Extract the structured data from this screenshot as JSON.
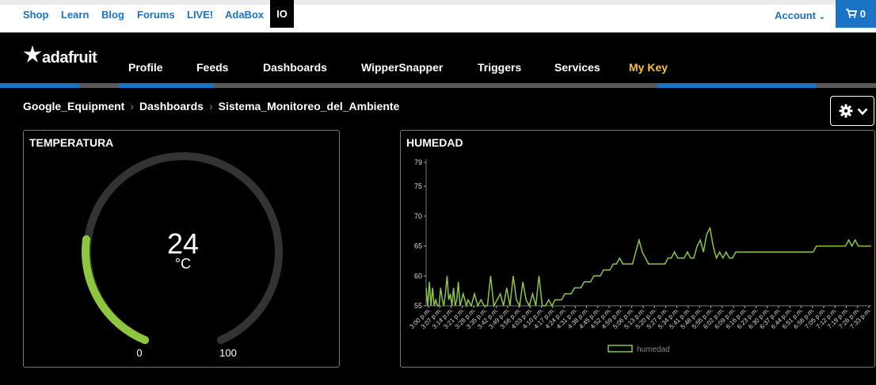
{
  "topnav": {
    "links": [
      "Shop",
      "Learn",
      "Blog",
      "Forums",
      "LIVE!",
      "AdaBox"
    ],
    "active": "IO",
    "account": "Account",
    "cart_count": "0"
  },
  "mainnav": {
    "brand": "adafruit",
    "items": [
      "Profile",
      "Feeds",
      "Dashboards",
      "WipperSnapper",
      "Triggers",
      "Services"
    ],
    "my_key": "My Key"
  },
  "breadcrumb": [
    "Google_Equipment",
    "Dashboards",
    "Sistema_Monitoreo_del_Ambiente"
  ],
  "colors": {
    "accent": "#1a73c4",
    "key": "#f6c23e",
    "series": "#8dc63f"
  },
  "gauge": {
    "title": "TEMPERATURA",
    "value": "24",
    "unit": "°C",
    "min": "0",
    "max": "100"
  },
  "chart_data": {
    "type": "line",
    "title": "HUMEDAD",
    "ylim": [
      55,
      79
    ],
    "y_ticks": [
      55,
      60,
      65,
      70,
      75,
      79
    ],
    "x_ticks": [
      "3:00 p.m.",
      "3:07 p.m.",
      "3:14 p.m.",
      "3:21 p.m.",
      "3:28 p.m.",
      "3:35 p.m.",
      "3:42 p.m.",
      "3:49 p.m.",
      "3:56 p.m.",
      "4:03 p.m.",
      "4:10 p.m.",
      "4:17 p.m.",
      "4:24 p.m.",
      "4:31 p.m.",
      "4:38 p.m.",
      "4:45 p.m.",
      "4:52 p.m.",
      "4:59 p.m.",
      "5:06 p.m.",
      "5:13 p.m.",
      "5:20 p.m.",
      "5:27 p.m.",
      "5:34 p.m.",
      "5:41 p.m.",
      "5:48 p.m.",
      "5:55 p.m.",
      "6:02 p.m.",
      "6:09 p.m.",
      "6:16 p.m.",
      "6:23 p.m.",
      "6:30 p.m.",
      "6:37 p.m.",
      "6:44 p.m.",
      "6:51 p.m.",
      "6:58 p.m.",
      "7:05 p.m.",
      "7:12 p.m.",
      "7:19 p.m.",
      "7:26 p.m.",
      "7:33 p.m."
    ],
    "series": [
      {
        "name": "humedad",
        "x": [
          0,
          1,
          2,
          3,
          4,
          5,
          6,
          7,
          8,
          9,
          10,
          11,
          12,
          13,
          14,
          15,
          16,
          17,
          18,
          19,
          20,
          21,
          22,
          23,
          24,
          25,
          26,
          28,
          30,
          32,
          34,
          36,
          38,
          40,
          42,
          44,
          46,
          48,
          50,
          52,
          54,
          56,
          58,
          60,
          62,
          64,
          66,
          68,
          70,
          72,
          74,
          76,
          78,
          80,
          82,
          84,
          86,
          88,
          90,
          92,
          94,
          96,
          98,
          100,
          102,
          104,
          106,
          108,
          110,
          112,
          114,
          116,
          118,
          120,
          122,
          124,
          126,
          128,
          130,
          132,
          134,
          136,
          138,
          140,
          142,
          144,
          146,
          148,
          150,
          152,
          154,
          156,
          158,
          160,
          162,
          164,
          166,
          168,
          170,
          172,
          174,
          176,
          178,
          180,
          182,
          184,
          186,
          188,
          190,
          192,
          194,
          196,
          198,
          200,
          202,
          204,
          206,
          208,
          210,
          212,
          214,
          216,
          218,
          220,
          222,
          224,
          226,
          228,
          230,
          232,
          234,
          236,
          238,
          240,
          242,
          244,
          246,
          248,
          250,
          252,
          254,
          256,
          258,
          260,
          262,
          264,
          266,
          268,
          270,
          272,
          274,
          276
        ],
        "y": [
          58,
          55,
          59,
          55,
          58,
          55,
          56,
          55,
          55,
          58,
          56,
          55,
          57,
          60,
          56,
          57,
          55,
          58,
          55,
          56,
          59,
          55,
          56,
          57,
          56,
          55,
          56,
          55,
          57,
          55,
          56,
          55,
          55,
          60,
          55,
          56,
          57,
          55,
          58,
          55,
          60,
          56,
          55,
          59,
          56,
          55,
          57,
          55,
          60,
          55,
          55,
          56,
          55,
          56,
          56,
          56,
          57,
          57,
          57,
          58,
          58,
          58,
          59,
          59,
          59,
          60,
          60,
          60,
          61,
          61,
          61,
          62,
          62,
          63,
          62,
          62,
          62,
          62,
          64,
          66,
          64,
          63,
          62,
          62,
          62,
          62,
          62,
          62,
          63,
          63,
          64,
          63,
          63,
          63,
          64,
          63,
          63,
          65,
          66,
          64,
          67,
          68,
          65,
          63,
          64,
          63,
          64,
          63,
          63,
          64,
          64,
          64,
          64,
          64,
          64,
          64,
          64,
          64,
          64,
          64,
          64,
          64,
          64,
          64,
          64,
          64,
          64,
          64,
          64,
          64,
          64,
          64,
          64,
          64,
          65,
          65,
          65,
          65,
          65,
          65,
          65,
          65,
          65,
          65,
          66,
          65,
          66,
          65,
          65,
          65,
          65,
          65
        ]
      }
    ]
  }
}
